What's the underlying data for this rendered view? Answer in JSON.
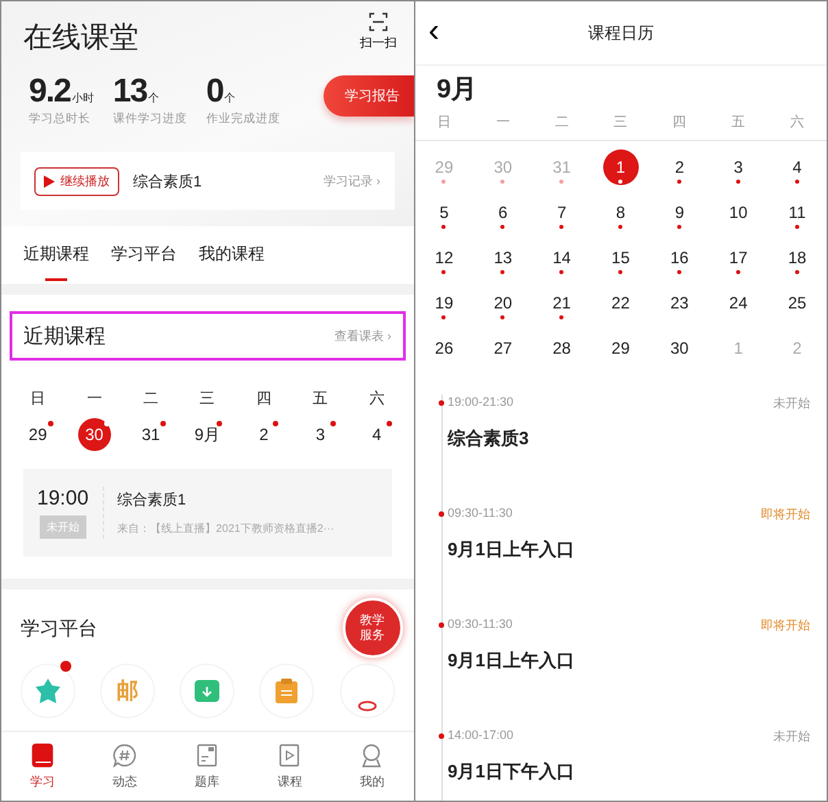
{
  "left": {
    "title": "在线课堂",
    "scan_label": "扫一扫",
    "stats": [
      {
        "value": "9.2",
        "unit": "小时",
        "label": "学习总时长"
      },
      {
        "value": "13",
        "unit": "个",
        "label": "课件学习进度"
      },
      {
        "value": "0",
        "unit": "个",
        "label": "作业完成进度"
      }
    ],
    "report_button": "学习报告",
    "continue_card": {
      "button": "继续播放",
      "course": "综合素质1",
      "link": "学习记录 ›"
    },
    "tabs": [
      {
        "label": "近期课程",
        "selected": true
      },
      {
        "label": "学习平台",
        "selected": false
      },
      {
        "label": "我的课程",
        "selected": false
      }
    ],
    "recent": {
      "title": "近期课程",
      "link": "查看课表 ›",
      "weekdays": [
        "日",
        "一",
        "二",
        "三",
        "四",
        "五",
        "六"
      ],
      "dates": [
        {
          "label": "29",
          "selected": false
        },
        {
          "label": "30",
          "selected": true
        },
        {
          "label": "31",
          "selected": false
        },
        {
          "label": "9月",
          "selected": false
        },
        {
          "label": "2",
          "selected": false
        },
        {
          "label": "3",
          "selected": false
        },
        {
          "label": "4",
          "selected": false
        }
      ],
      "course": {
        "time": "19:00",
        "status": "未开始",
        "title": "综合素质1",
        "source": "来自：【线上直播】2021下教师资格直播2···"
      }
    },
    "platform": {
      "title": "学习平台",
      "icons": [
        {
          "kind": "star",
          "badge": true
        },
        {
          "kind": "char",
          "text": "邮",
          "badge": false
        },
        {
          "kind": "download",
          "badge": false
        },
        {
          "kind": "clipboard",
          "badge": false
        },
        {
          "kind": "partial",
          "badge": false
        }
      ],
      "fab": "教学服务"
    },
    "nav": [
      {
        "label": "学习",
        "kind": "book",
        "selected": true
      },
      {
        "label": "动态",
        "kind": "hash",
        "selected": false
      },
      {
        "label": "题库",
        "kind": "doc",
        "selected": false
      },
      {
        "label": "课程",
        "kind": "play",
        "selected": false
      },
      {
        "label": "我的",
        "kind": "person",
        "selected": false
      }
    ]
  },
  "right": {
    "back": "‹",
    "title": "课程日历",
    "month": "9月",
    "weekdays": [
      "日",
      "一",
      "二",
      "三",
      "四",
      "五",
      "六"
    ],
    "days": [
      {
        "label": "29",
        "muted": true,
        "dot": true,
        "selected": false
      },
      {
        "label": "30",
        "muted": true,
        "dot": true,
        "selected": false
      },
      {
        "label": "31",
        "muted": true,
        "dot": true,
        "selected": false
      },
      {
        "label": "1",
        "muted": false,
        "dot": true,
        "selected": true
      },
      {
        "label": "2",
        "muted": false,
        "dot": true,
        "selected": false
      },
      {
        "label": "3",
        "muted": false,
        "dot": true,
        "selected": false
      },
      {
        "label": "4",
        "muted": false,
        "dot": true,
        "selected": false
      },
      {
        "label": "5",
        "muted": false,
        "dot": true,
        "selected": false
      },
      {
        "label": "6",
        "muted": false,
        "dot": true,
        "selected": false
      },
      {
        "label": "7",
        "muted": false,
        "dot": true,
        "selected": false
      },
      {
        "label": "8",
        "muted": false,
        "dot": true,
        "selected": false
      },
      {
        "label": "9",
        "muted": false,
        "dot": true,
        "selected": false
      },
      {
        "label": "10",
        "muted": false,
        "dot": false,
        "selected": false
      },
      {
        "label": "11",
        "muted": false,
        "dot": true,
        "selected": false
      },
      {
        "label": "12",
        "muted": false,
        "dot": true,
        "selected": false
      },
      {
        "label": "13",
        "muted": false,
        "dot": true,
        "selected": false
      },
      {
        "label": "14",
        "muted": false,
        "dot": true,
        "selected": false
      },
      {
        "label": "15",
        "muted": false,
        "dot": true,
        "selected": false
      },
      {
        "label": "16",
        "muted": false,
        "dot": true,
        "selected": false
      },
      {
        "label": "17",
        "muted": false,
        "dot": true,
        "selected": false
      },
      {
        "label": "18",
        "muted": false,
        "dot": true,
        "selected": false
      },
      {
        "label": "19",
        "muted": false,
        "dot": true,
        "selected": false
      },
      {
        "label": "20",
        "muted": false,
        "dot": true,
        "selected": false
      },
      {
        "label": "21",
        "muted": false,
        "dot": true,
        "selected": false
      },
      {
        "label": "22",
        "muted": false,
        "dot": false,
        "selected": false
      },
      {
        "label": "23",
        "muted": false,
        "dot": false,
        "selected": false
      },
      {
        "label": "24",
        "muted": false,
        "dot": false,
        "selected": false
      },
      {
        "label": "25",
        "muted": false,
        "dot": false,
        "selected": false
      },
      {
        "label": "26",
        "muted": false,
        "dot": false,
        "selected": false
      },
      {
        "label": "27",
        "muted": false,
        "dot": false,
        "selected": false
      },
      {
        "label": "28",
        "muted": false,
        "dot": false,
        "selected": false
      },
      {
        "label": "29",
        "muted": false,
        "dot": false,
        "selected": false
      },
      {
        "label": "30",
        "muted": false,
        "dot": false,
        "selected": false
      },
      {
        "label": "1",
        "muted": true,
        "dot": false,
        "selected": false
      },
      {
        "label": "2",
        "muted": true,
        "dot": false,
        "selected": false
      }
    ],
    "events": [
      {
        "time": "19:00-21:30",
        "status": "未开始",
        "kind": "pending",
        "title": "综合素质3"
      },
      {
        "time": "09:30-11:30",
        "status": "即将开始",
        "kind": "soon",
        "title": "9月1日上午入口"
      },
      {
        "time": "09:30-11:30",
        "status": "即将开始",
        "kind": "soon",
        "title": "9月1日上午入口"
      },
      {
        "time": "14:00-17:00",
        "status": "未开始",
        "kind": "pending",
        "title": "9月1日下午入口"
      }
    ]
  }
}
